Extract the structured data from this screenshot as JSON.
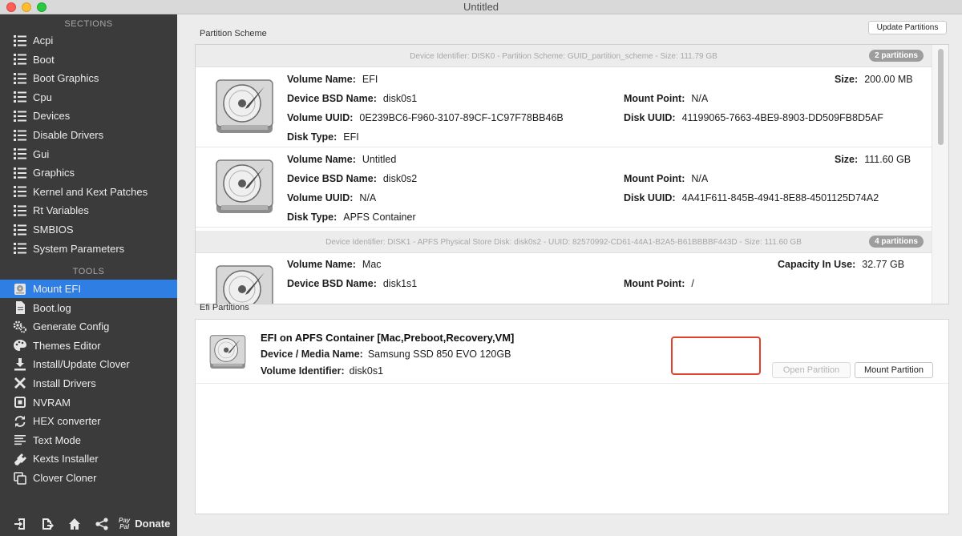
{
  "window": {
    "title": "Untitled"
  },
  "sidebar": {
    "sections_header": "SECTIONS",
    "sections": [
      {
        "label": "Acpi",
        "icon": "list-icon"
      },
      {
        "label": "Boot",
        "icon": "list-icon"
      },
      {
        "label": "Boot Graphics",
        "icon": "list-icon"
      },
      {
        "label": "Cpu",
        "icon": "list-icon"
      },
      {
        "label": "Devices",
        "icon": "list-icon"
      },
      {
        "label": "Disable Drivers",
        "icon": "list-icon"
      },
      {
        "label": "Gui",
        "icon": "list-icon"
      },
      {
        "label": "Graphics",
        "icon": "list-icon"
      },
      {
        "label": "Kernel and Kext Patches",
        "icon": "list-icon"
      },
      {
        "label": "Rt Variables",
        "icon": "list-icon"
      },
      {
        "label": "SMBIOS",
        "icon": "list-icon"
      },
      {
        "label": "System Parameters",
        "icon": "list-icon"
      }
    ],
    "tools_header": "TOOLS",
    "tools": [
      {
        "label": "Mount EFI",
        "icon": "disk-icon",
        "active": true
      },
      {
        "label": "Boot.log",
        "icon": "document-icon"
      },
      {
        "label": "Generate Config",
        "icon": "gears-icon"
      },
      {
        "label": "Themes Editor",
        "icon": "palette-icon"
      },
      {
        "label": "Install/Update Clover",
        "icon": "download-icon"
      },
      {
        "label": "Install Drivers",
        "icon": "wrench-icon"
      },
      {
        "label": "NVRAM",
        "icon": "chip-icon"
      },
      {
        "label": "HEX converter",
        "icon": "refresh-icon"
      },
      {
        "label": "Text Mode",
        "icon": "text-lines-icon"
      },
      {
        "label": "Kexts Installer",
        "icon": "plug-icon"
      },
      {
        "label": "Clover Cloner",
        "icon": "copy-icon"
      }
    ],
    "bottom": {
      "icons": [
        "import-icon",
        "export-icon",
        "home-icon",
        "share-icon"
      ],
      "paypal_text": [
        "Pay",
        "Pal"
      ],
      "donate_label": "Donate"
    }
  },
  "main": {
    "update_button": "Update Partitions",
    "partition_scheme_label": "Partition Scheme",
    "disks": [
      {
        "header": "Device Identifier: DISK0 - Partition Scheme: GUID_partition_scheme - Size: 111.79 GB",
        "badge": "2 partitions"
      },
      {
        "header": "Device Identifier: DISK1 - APFS Physical Store Disk: disk0s2 - UUID: 82570992-CD61-44A1-B2A5-B61BBBBF443D - Size: 111.60 GB",
        "badge": "4 partitions"
      }
    ],
    "partitions": [
      {
        "volume_name_label": "Volume Name:",
        "volume_name": "EFI",
        "size_label": "Size:",
        "size": "200.00 MB",
        "bsd_label": "Device BSD Name:",
        "bsd": "disk0s1",
        "mount_label": "Mount Point:",
        "mount": "N/A",
        "vuuid_label": "Volume UUID:",
        "vuuid": "0E239BC6-F960-3107-89CF-1C97F78BB46B",
        "duuid_label": "Disk UUID:",
        "duuid": "41199065-7663-4BE9-8903-DD509FB8D5AF",
        "type_label": "Disk Type:",
        "type": "EFI"
      },
      {
        "volume_name_label": "Volume Name:",
        "volume_name": "Untitled",
        "size_label": "Size:",
        "size": "111.60 GB",
        "bsd_label": "Device BSD Name:",
        "bsd": "disk0s2",
        "mount_label": "Mount Point:",
        "mount": "N/A",
        "vuuid_label": "Volume UUID:",
        "vuuid": "N/A",
        "duuid_label": "Disk UUID:",
        "duuid": "4A41F611-845B-4941-8E88-4501125D74A2",
        "type_label": "Disk Type:",
        "type": "APFS Container"
      },
      {
        "volume_name_label": "Volume Name:",
        "volume_name": "Mac",
        "size_label": "Capacity In Use:",
        "size": "32.77 GB",
        "bsd_label": "Device BSD Name:",
        "bsd": "disk1s1",
        "mount_label": "Mount Point:",
        "mount": "/"
      }
    ],
    "efi_partitions_label": "Efi Partitions",
    "efi": {
      "title": "EFI on APFS Container [Mac,Preboot,Recovery,VM]",
      "media_label": "Device / Media Name:",
      "media": "Samsung SSD 850 EVO 120GB",
      "vid_label": "Volume Identifier:",
      "vid": "disk0s1",
      "open_button": "Open Partition",
      "mount_button": "Mount Partition"
    }
  },
  "colors": {
    "sidebar_bg": "#3b3b3b",
    "active": "#2f7ee3",
    "highlight": "#e2412c"
  }
}
